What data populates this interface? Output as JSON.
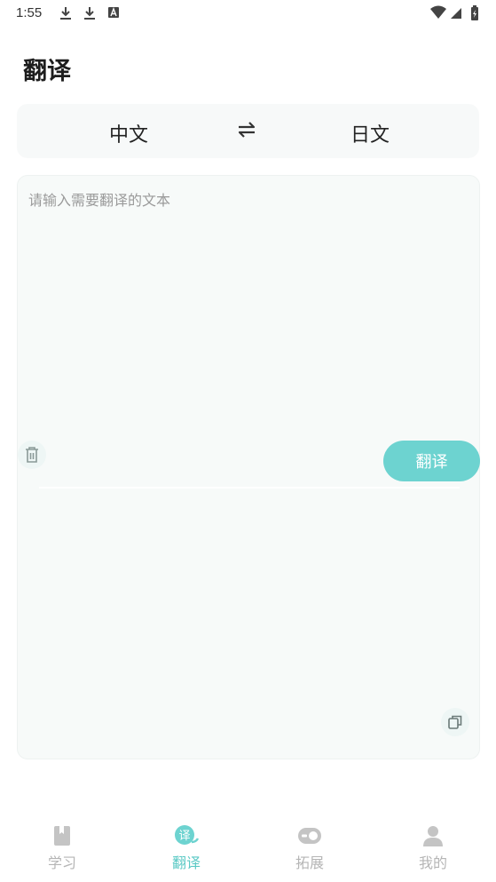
{
  "status_bar": {
    "time": "1:55"
  },
  "header": {
    "title": "翻译"
  },
  "languages": {
    "source": "中文",
    "target": "日文"
  },
  "input": {
    "placeholder": "请输入需要翻译的文本",
    "value": ""
  },
  "actions": {
    "translate_label": "翻译"
  },
  "result": {
    "text": ""
  },
  "tabs": [
    {
      "label": "学习",
      "icon": "book-icon",
      "active": false
    },
    {
      "label": "翻译",
      "icon": "translate-icon",
      "active": true
    },
    {
      "label": "拓展",
      "icon": "toggle-icon",
      "active": false
    },
    {
      "label": "我的",
      "icon": "person-icon",
      "active": false
    }
  ],
  "colors": {
    "accent": "#6dd3d0",
    "accent_text": "#5bc9c5",
    "inactive": "#b5b5b5"
  }
}
